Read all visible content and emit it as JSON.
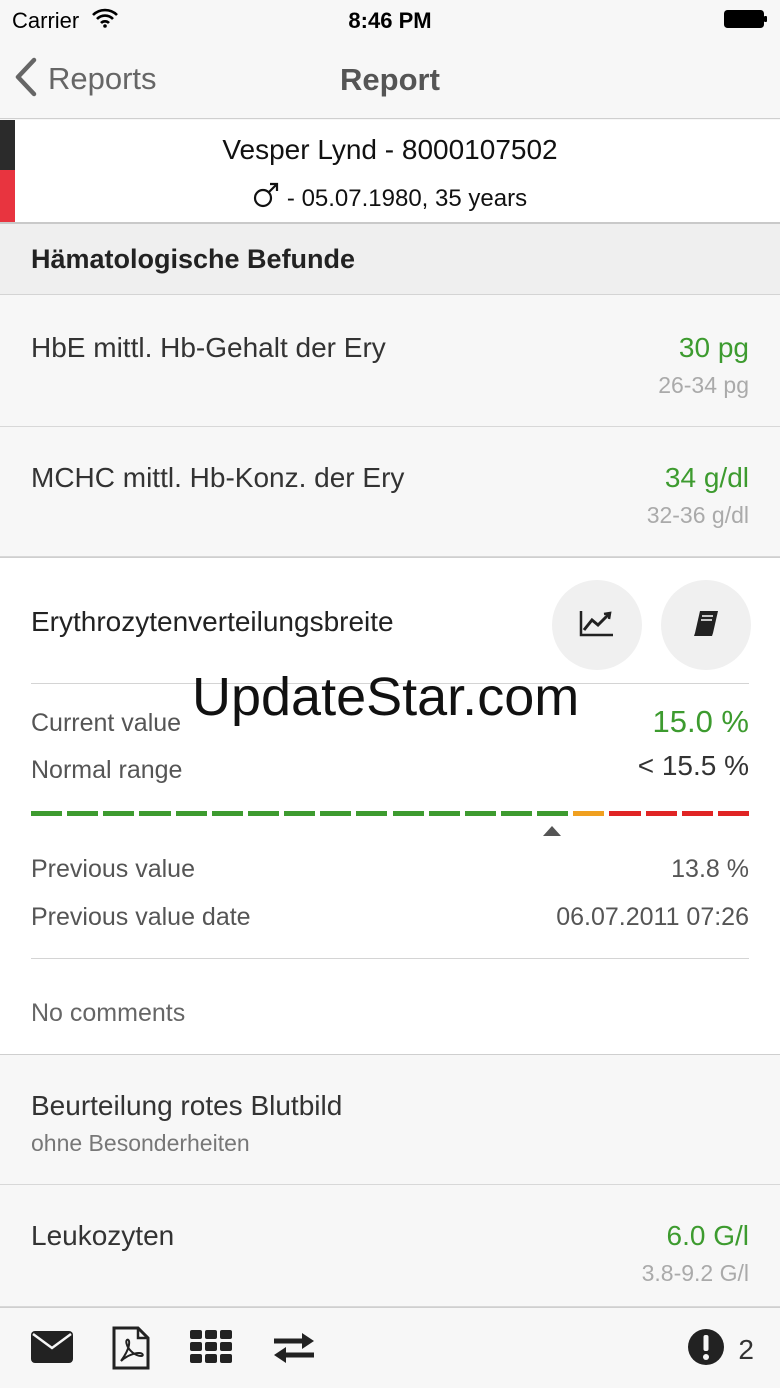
{
  "status_bar": {
    "carrier": "Carrier",
    "time": "8:46 PM"
  },
  "nav": {
    "back_label": "Reports",
    "title": "Report"
  },
  "patient": {
    "name": "Vesper Lynd - 8000107502",
    "details": "- 05.07.1980, 35 years",
    "gender_icon": "male-symbol-icon"
  },
  "section": {
    "title": "Hämatologische Befunde"
  },
  "rows": [
    {
      "label": "HbE mittl. Hb-Gehalt der Ery",
      "value": "30 pg",
      "range": "26-34 pg"
    },
    {
      "label": "MCHC mittl. Hb-Konz. der Ery",
      "value": "34 g/dl",
      "range": "32-36 g/dl"
    }
  ],
  "detail": {
    "title": "Erythrozytenverteilungsbreite",
    "current_label": "Current value",
    "current_value": "15.0 %",
    "normal_label": "Normal range",
    "normal_value": "< 15.5 %",
    "scale": {
      "segments": 20,
      "green": 15,
      "orange": 1,
      "red": 4,
      "marker_position": 0.725
    },
    "previous_label": "Previous value",
    "previous_value": "13.8 %",
    "previous_date_label": "Previous value date",
    "previous_date_value": "06.07.2011 07:26",
    "comments": "No comments"
  },
  "assessment": {
    "label": "Beurteilung rotes Blutbild",
    "sub": "ohne Besonderheiten"
  },
  "leuko": {
    "label": "Leukozyten",
    "value": "6.0 G/l",
    "range": "3.8-9.2 G/l"
  },
  "watermark": "UpdateStar.com",
  "toolbar": {
    "alert_count": "2"
  },
  "colors": {
    "accent_green": "#3d9b2f",
    "warning_orange": "#f0a020",
    "alert_red": "#e02424",
    "patient_stripe_red": "#e8343f"
  }
}
